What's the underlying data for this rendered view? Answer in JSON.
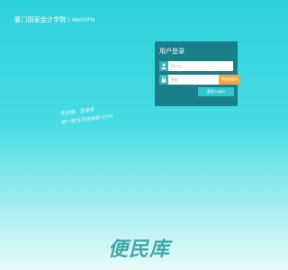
{
  "header": {
    "school_name": "厦门国家会计学院",
    "separator": "|",
    "product_name": "WebVPN"
  },
  "login": {
    "title": "用户登录",
    "username_placeholder": "用户名",
    "sms_placeholder": "密码",
    "sms_button_label": "获取验证码",
    "login_button_label": "登录 Login",
    "user_icon": "user-icon",
    "lock_icon": "lock-icon"
  },
  "slogan": {
    "line1": "无论我，您身在",
    "line2": "统一前方开启你的 VPN"
  },
  "watermark": "便民库",
  "colors": {
    "panel": "#1a7f88",
    "icon_tile": "#2fb3bd",
    "sms_button": "#f4a640",
    "login_button": "#2fc6d2"
  }
}
